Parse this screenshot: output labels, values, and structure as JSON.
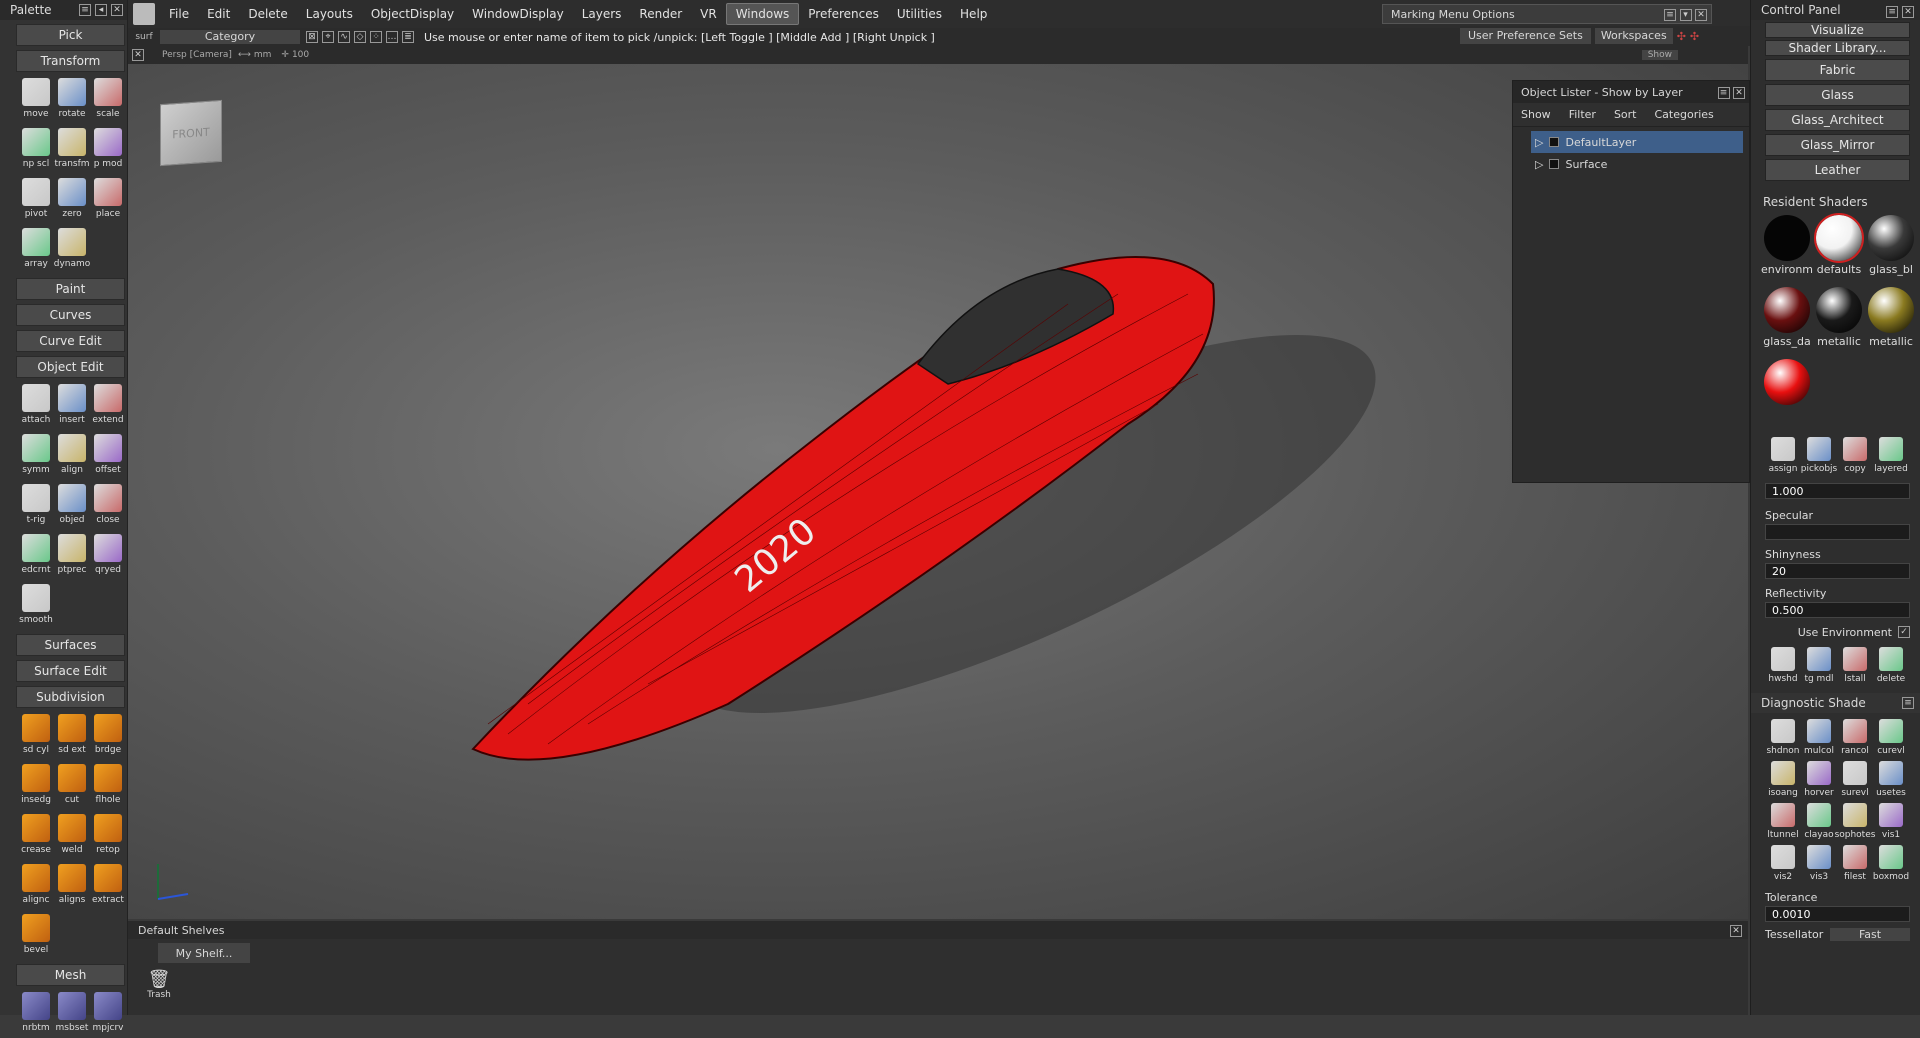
{
  "palette": {
    "title": "Palette",
    "sections": {
      "pick": "Pick",
      "transform": "Transform",
      "paint": "Paint",
      "curves": "Curves",
      "curve_edit": "Curve Edit",
      "object_edit": "Object Edit",
      "surfaces": "Surfaces",
      "surface_edit": "Surface Edit",
      "subdivision": "Subdivision",
      "mesh": "Mesh"
    },
    "transform_tools": [
      "move",
      "rotate",
      "scale",
      "np scl",
      "transfm",
      "p mod",
      "pivot",
      "zero",
      "place",
      "array",
      "dynamo"
    ],
    "object_edit_tools": [
      "attach",
      "insert",
      "extend",
      "symm",
      "align",
      "offset",
      "t-rig",
      "objed",
      "close",
      "edcrnt",
      "ptprec",
      "qryed",
      "smooth"
    ],
    "subdivision_tools": [
      "sd cyl",
      "sd ext",
      "brdge",
      "insedg",
      "cut",
      "flhole",
      "crease",
      "weld",
      "retop",
      "alignc",
      "aligns",
      "extract",
      "bevel"
    ],
    "mesh_tools": [
      "nrbtm",
      "msbset",
      "mpjcrv"
    ]
  },
  "menubar": {
    "items": [
      "File",
      "Edit",
      "Delete",
      "Layouts",
      "ObjectDisplay",
      "WindowDisplay",
      "Layers",
      "Render",
      "VR",
      "Windows",
      "Preferences",
      "Utilities",
      "Help"
    ],
    "selected": "Windows"
  },
  "marking_menu": {
    "title": "Marking Menu Options"
  },
  "toolbar": {
    "surf": "surf",
    "category": "Category",
    "prompt": "Use mouse or enter name of item to pick /unpick: [Left Toggle ] [Middle Add ] [Right Unpick ]",
    "user_pref_sets": "User Preference Sets",
    "workspaces": "Workspaces"
  },
  "viewport": {
    "label": "Persp [Camera]",
    "units": "mm",
    "scale": "100",
    "show_label": "Show",
    "cube_face": "FRONT",
    "model_text": "2020"
  },
  "object_lister": {
    "title": "Object Lister - Show by Layer",
    "tabs": [
      "Show",
      "Filter",
      "Sort",
      "Categories"
    ],
    "items": [
      "DefaultLayer",
      "Surface"
    ]
  },
  "control_panel": {
    "title": "Control Panel",
    "visualize": "Visualize",
    "shader_library": "Shader Library...",
    "library_items": [
      "Fabric",
      "Glass",
      "Glass_Architect",
      "Glass_Mirror",
      "Leather"
    ],
    "resident_shaders_title": "Resident Shaders",
    "shaders": [
      {
        "name": "environm",
        "color": "#050505"
      },
      {
        "name": "defaults",
        "color": "#f2f2f2"
      },
      {
        "name": "glass_bl",
        "color": "#3a3a3a"
      },
      {
        "name": "glass_da",
        "color": "#6a1010"
      },
      {
        "name": "metallic",
        "color": "#1a1a1a"
      },
      {
        "name": "metallic",
        "color": "#8a7a20"
      },
      {
        "name": "",
        "color": "#e81010"
      }
    ],
    "shader_tools": [
      "assign",
      "pickobjs",
      "copy",
      "layered"
    ],
    "value_top": "1.000",
    "specular_label": "Specular",
    "shininess_label": "Shinyness",
    "shininess_value": "20",
    "reflectivity_label": "Reflectivity",
    "reflectivity_value": "0.500",
    "use_env_label": "Use Environment",
    "model_tools": [
      "hwshd",
      "tg mdl",
      "lstall",
      "delete"
    ],
    "diagnostic_title": "Diagnostic Shade",
    "diagnostic_tools": [
      "shdnon",
      "mulcol",
      "rancol",
      "curevl",
      "isoang",
      "horver",
      "surevl",
      "usetes",
      "ltunnel",
      "clayao",
      "sophotes",
      "vis1",
      "vis2",
      "vis3",
      "filest",
      "boxmod"
    ],
    "tolerance_label": "Tolerance",
    "tolerance_value": "0.0010",
    "tessellator_label": "Tessellator",
    "tessellator_value": "Fast"
  },
  "shelves": {
    "title": "Default Shelves",
    "tab": "My Shelf...",
    "trash": "Trash"
  }
}
